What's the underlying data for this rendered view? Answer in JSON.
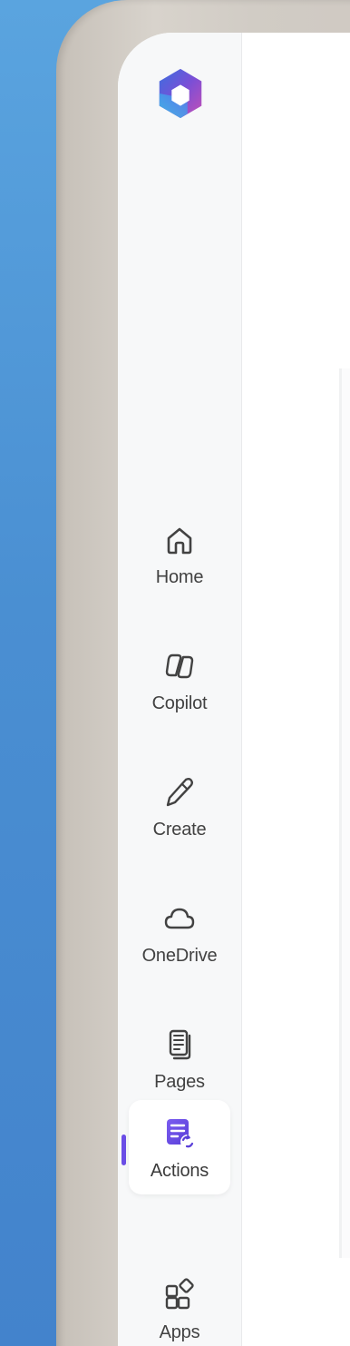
{
  "nav": {
    "items": [
      {
        "label": "Home",
        "icon": "home-icon"
      },
      {
        "label": "Copilot",
        "icon": "copilot-icon"
      },
      {
        "label": "Create",
        "icon": "pen-icon"
      },
      {
        "label": "OneDrive",
        "icon": "cloud-icon"
      },
      {
        "label": "Pages",
        "icon": "pages-icon"
      },
      {
        "label": "Actions",
        "icon": "actions-icon",
        "active": true
      },
      {
        "label": "Apps",
        "icon": "apps-icon"
      }
    ]
  },
  "colors": {
    "background_blue": "#4a8fd2",
    "frame": "#d1ccc5",
    "rail": "#f7f8f9",
    "accent": "#6b4ee6",
    "text": "#424242"
  }
}
